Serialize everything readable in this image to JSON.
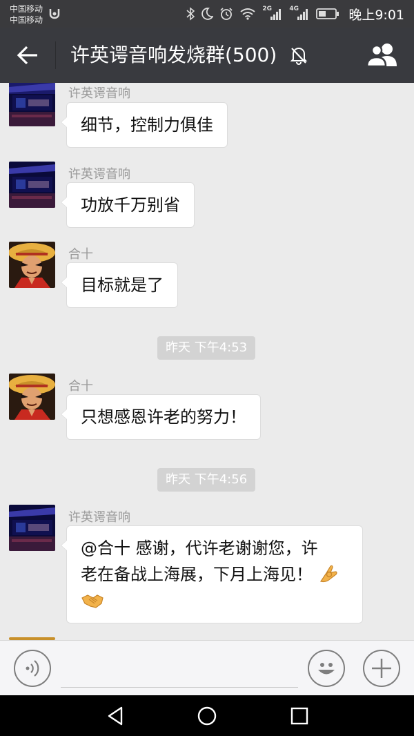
{
  "status_bar": {
    "carrier_1": "中国移动",
    "carrier_2": "中国移动",
    "network_1": "2G",
    "network_2": "4G",
    "time": "晚上9:01"
  },
  "title_bar": {
    "title": "许英谔音响发烧群(500)",
    "muted": true
  },
  "messages": [
    {
      "type": "text",
      "sender": "许英谔音响",
      "avatar": "concert-hall-avatar",
      "text": "细节，控制力俱佳"
    },
    {
      "type": "text",
      "sender": "许英谔音响",
      "avatar": "concert-hall-avatar",
      "text": "功放千万别省"
    },
    {
      "type": "text",
      "sender": "合十",
      "avatar": "straw-hat-avatar",
      "text": "目标就是了"
    },
    {
      "type": "time",
      "text": "昨天  下午4:53"
    },
    {
      "type": "text",
      "sender": "合十",
      "avatar": "straw-hat-avatar",
      "text": "只想感恩许老的努力！"
    },
    {
      "type": "time",
      "text": "昨天  下午4:56"
    },
    {
      "type": "text",
      "sender": "许英谔音响",
      "avatar": "concert-hall-avatar",
      "text_line_1": "@合十  感谢，代许老谢谢您，许",
      "text_line_2": "老在备战上海展，下月上海见！",
      "emoji_1": "ok-hand-emoji",
      "emoji_2": "handshake-emoji"
    }
  ],
  "input_bar": {
    "value": "",
    "placeholder": ""
  },
  "colors": {
    "title_bar_bg": "#393a3f",
    "status_bar_bg": "#3a3a3d",
    "chat_bg": "#ebebeb",
    "bubble_bg": "#ffffff",
    "timestamp_bg": "#d3d3d3"
  }
}
